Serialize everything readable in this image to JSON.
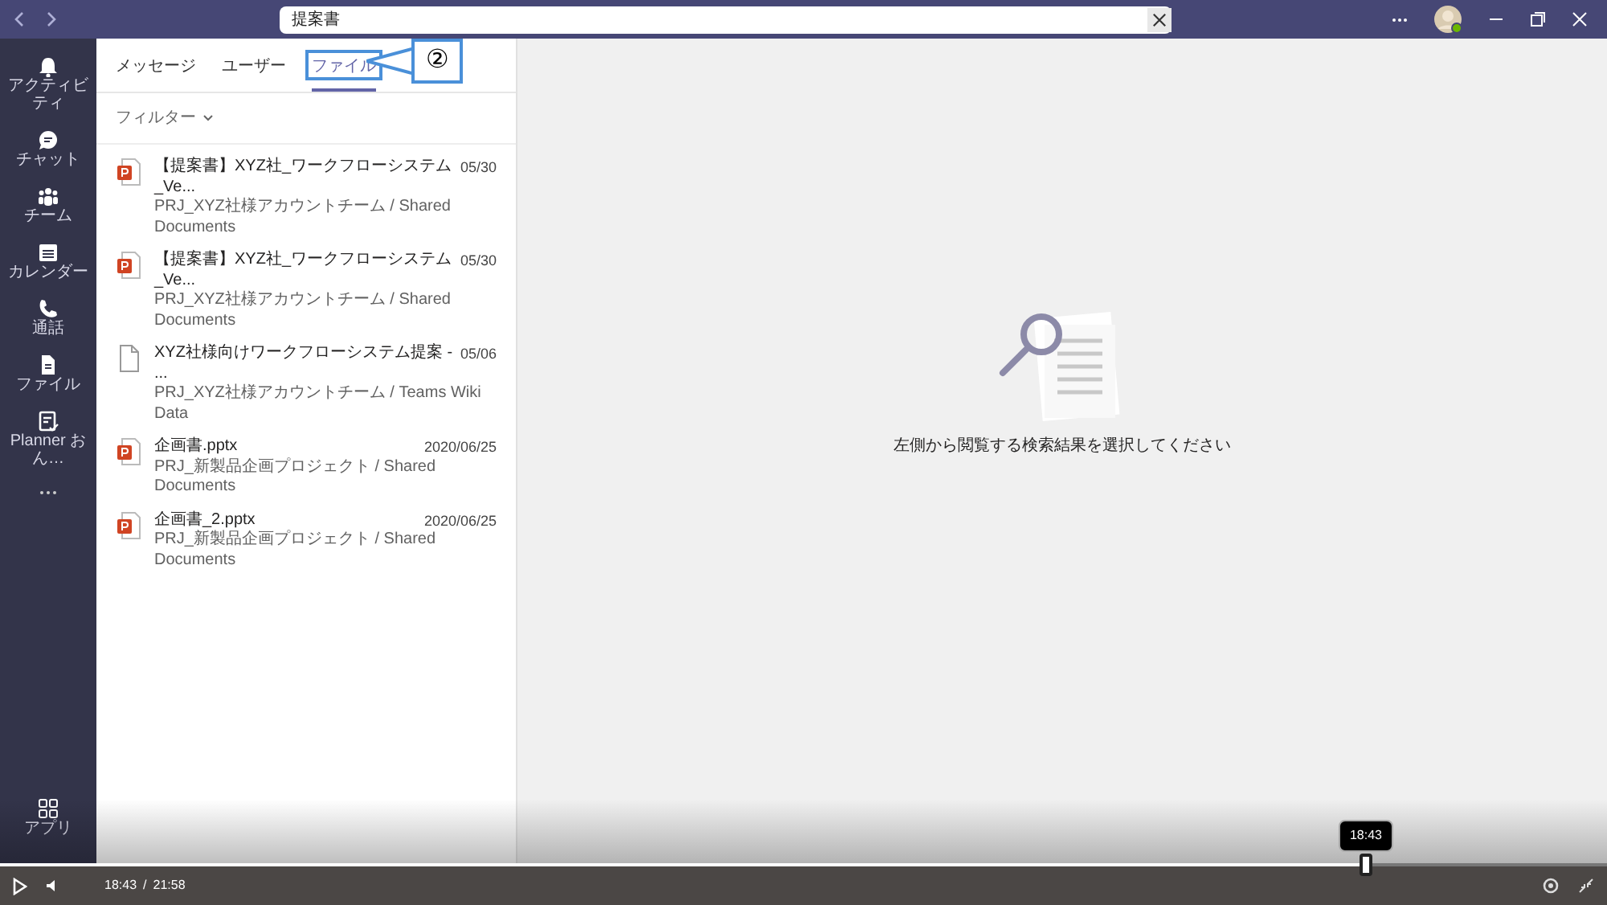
{
  "app": {
    "search": {
      "value": "提案書"
    },
    "rail": [
      {
        "label": "アクティビティ",
        "kind": "bell"
      },
      {
        "label": "チャット",
        "kind": "chat"
      },
      {
        "label": "チーム",
        "kind": "team"
      },
      {
        "label": "カレンダー",
        "kind": "calendar"
      },
      {
        "label": "通話",
        "kind": "phone"
      },
      {
        "label": "ファイル",
        "kind": "file"
      },
      {
        "label": "Planner おん…",
        "kind": "planner"
      }
    ],
    "rail_bottom": {
      "label": "アプリ",
      "kind": "apps"
    },
    "tabs": [
      {
        "label": "メッセージ",
        "selected": false
      },
      {
        "label": "ユーザー",
        "selected": false
      },
      {
        "label": "ファイル",
        "selected": true
      }
    ],
    "filter": "フィルター",
    "results": [
      {
        "name": "【提案書】XYZ社_ワークフローシステム_Ve...",
        "date": "05/30",
        "location": "PRJ_XYZ社様アカウントチーム / Shared Documents",
        "kind": "pptx"
      },
      {
        "name": "【提案書】XYZ社_ワークフローシステム_Ve...",
        "date": "05/30",
        "location": "PRJ_XYZ社様アカウントチーム / Shared Documents",
        "kind": "pptx"
      },
      {
        "name": "XYZ社様向けワークフローシステム提案 - ...",
        "date": "05/06",
        "location": "PRJ_XYZ社様アカウントチーム / Teams Wiki Data",
        "kind": "page"
      },
      {
        "name": "企画書.pptx",
        "date": "2020/06/25",
        "location": "PRJ_新製品企画プロジェクト / Shared Documents",
        "kind": "pptx"
      },
      {
        "name": "企画書_2.pptx",
        "date": "2020/06/25",
        "location": "PRJ_新製品企画プロジェクト / Shared Documents",
        "kind": "pptx"
      }
    ],
    "empty_state": "左側から閲覧する検索結果を選択してください",
    "callout": {
      "label": "②"
    }
  },
  "player": {
    "current": "18:43",
    "separator": "/",
    "total": "21:58",
    "tooltip": "18:43",
    "level": 0.85
  }
}
